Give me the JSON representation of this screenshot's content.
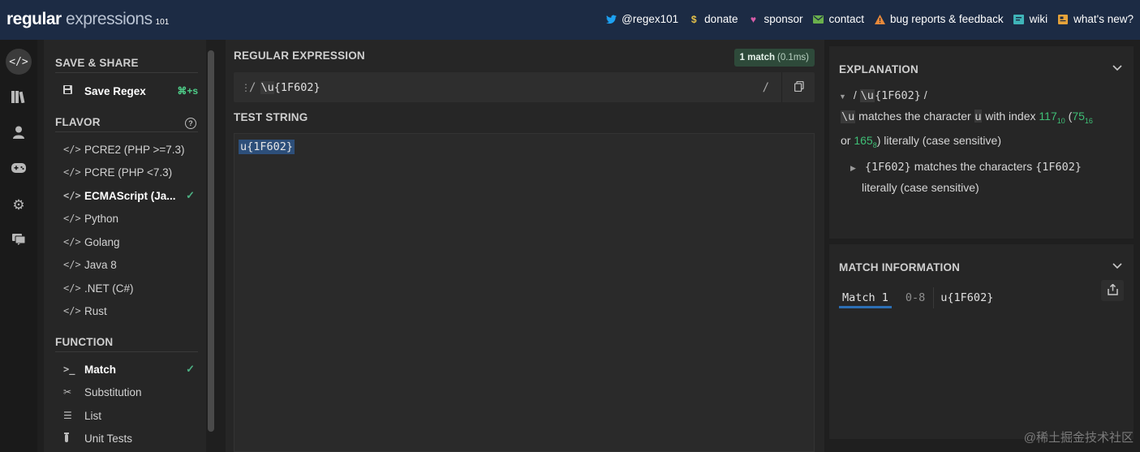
{
  "header": {
    "logo_part1": "regular",
    "logo_part2": "expressions",
    "logo_num": "101",
    "nav": [
      {
        "label": "@regex101",
        "icon": "twitter-icon",
        "color": "#1da1f2"
      },
      {
        "label": "donate",
        "icon": "dollar-icon",
        "color": "#e6c24a"
      },
      {
        "label": "sponsor",
        "icon": "heart-icon",
        "color": "#d65ca8"
      },
      {
        "label": "contact",
        "icon": "mail-icon",
        "color": "#6ab04c"
      },
      {
        "label": "bug reports & feedback",
        "icon": "warning-icon",
        "color": "#e8893a"
      },
      {
        "label": "wiki",
        "icon": "book-icon",
        "color": "#3fb4b8"
      },
      {
        "label": "what's new?",
        "icon": "news-icon",
        "color": "#e6a33a"
      }
    ]
  },
  "rail": [
    {
      "icon": "code-icon",
      "active": true
    },
    {
      "icon": "library-icon"
    },
    {
      "icon": "user-icon"
    },
    {
      "icon": "gamepad-icon"
    },
    {
      "icon": "settings-icon"
    },
    {
      "icon": "chat-icon"
    }
  ],
  "sidebar": {
    "save_title": "SAVE & SHARE",
    "save_label": "Save Regex",
    "save_shortcut": "⌘+s",
    "flavor_title": "FLAVOR",
    "flavors": [
      "PCRE2 (PHP >=7.3)",
      "PCRE (PHP <7.3)",
      "ECMAScript (Ja...",
      "Python",
      "Golang",
      "Java 8",
      ".NET (C#)",
      "Rust"
    ],
    "selected_flavor": "ECMAScript (Ja...",
    "function_title": "FUNCTION",
    "functions": [
      "Match",
      "Substitution",
      "List",
      "Unit Tests"
    ],
    "selected_function": "Match"
  },
  "center": {
    "regex_title": "REGULAR EXPRESSION",
    "match_count": "1 match",
    "match_time": "(0.1ms)",
    "regex_delim": "/",
    "regex_escape": "\\u",
    "regex_rest": "{1F602}",
    "flag_delim": "/",
    "test_title": "TEST STRING",
    "test_string": "u{1F602}"
  },
  "explanation": {
    "title": "EXPLANATION",
    "root_slash_open": "/",
    "root_escape": "\\u",
    "root_rest": "{1F602}",
    "root_slash_close": "/",
    "line1_escape": "\\u",
    "line1_text": "matches the character",
    "line1_char": "u",
    "line1_text2": "with index",
    "idx_dec": "117",
    "idx_dec_base": "10",
    "idx_hex": "75",
    "idx_hex_base": "16",
    "line2_or": "or",
    "idx_oct": "165",
    "idx_oct_base": "8",
    "line2_rest": ") literally (case sensitive)",
    "child_token": "{1F602}",
    "child_text": "matches the characters",
    "child_token2": "{1F602}",
    "child_text2": "literally (case sensitive)"
  },
  "match_info": {
    "title": "MATCH INFORMATION",
    "match_label": "Match 1",
    "range": "0-8",
    "value": "u{1F602}"
  },
  "watermark": "@稀土掘金技术社区"
}
